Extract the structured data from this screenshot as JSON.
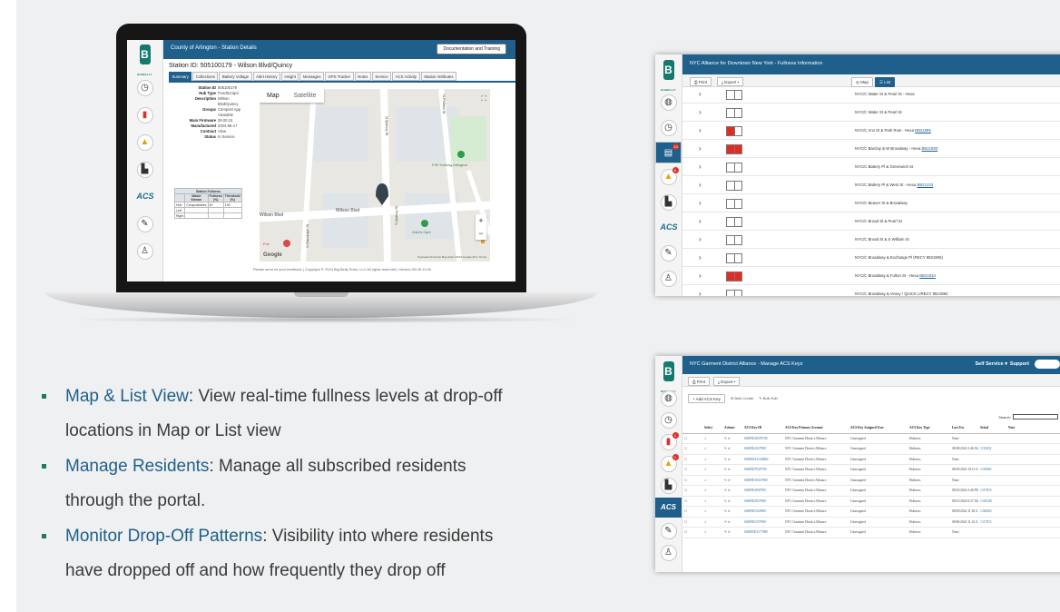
{
  "laptop": {
    "header_title": "County of Arlington - Station Details",
    "doc_button": "Documentation and Training",
    "station_title": "Station ID: 505100179 - Wilson Blvd/Quincy",
    "tabs": [
      "Summary",
      "Collections",
      "Battery Voltage",
      "Alert History",
      "Height",
      "Messages",
      "GPS Tracker",
      "Notes",
      "Service",
      "ACS Activity",
      "Station Attributes"
    ],
    "info": [
      {
        "k": "Station ID",
        "v": "505100179"
      },
      {
        "k": "Hub Type",
        "v": "FoodScrap3"
      },
      {
        "k": "Description",
        "v": "Wilson"
      },
      {
        "k": "",
        "v": "Blvd/Quincy"
      },
      {
        "k": "Groups",
        "v": "Compost App"
      },
      {
        "k": "",
        "v": "Viewable"
      },
      {
        "k": "Main Firmware",
        "v": "38.00.15"
      },
      {
        "k": "Manufactured",
        "v": "2024-06-17"
      },
      {
        "k": "Contract",
        "v": "View"
      },
      {
        "k": "Status",
        "v": "In Service"
      }
    ],
    "fullness": {
      "title": "Station Fullness",
      "headers": [
        "",
        "Waste Stream",
        "Fullness (%)",
        "Threshold (%)"
      ],
      "rows": [
        [
          "Hub",
          "Compostables",
          "40",
          "100"
        ],
        [
          "Left",
          "",
          "",
          ""
        ],
        [
          "Right",
          "",
          "",
          ""
        ]
      ]
    },
    "map": {
      "tab_map": "Map",
      "tab_satellite": "Satellite",
      "roads": {
        "wilson_left": "Wilson Blvd",
        "wilson_mid": "Wilson Blvd",
        "quincy": "N Quincy St",
        "quincy2": "N Quincy St",
        "pollard": "N Pollard St",
        "randolph": "N Randolph St"
      },
      "places": {
        "fitness": "F45 Training Arlington",
        "gym": "Gold's Gym",
        "fox": "Fox"
      },
      "google": "Google",
      "attribution": "Keyboard shortcuts  Map data ©2024 Google  20 m  Terms"
    },
    "footer": "Please send us your feedback | Copyright © 2024 Big Belly Solar, LLC All rights reserved | Version 08.08.19.00"
  },
  "panel1": {
    "title": "NYC Alliance for Downtown New York - Fullness Information",
    "print": "Print",
    "export": "Export",
    "map": "Map",
    "list": "List",
    "rows": [
      {
        "fill": [
          0,
          0
        ],
        "addr": "NYC/C Water St & Pearl St - Hexa"
      },
      {
        "fill": [
          0,
          0
        ],
        "addr": "NYC/C Water St & Pearl St"
      },
      {
        "fill": [
          1,
          0
        ],
        "addr": "NYC/C Ann St & Park Row - Hexa ",
        "link": "BB21895"
      },
      {
        "fill": [
          1,
          1
        ],
        "addr": "NYC/C Barclay & W Broadway - Hexa ",
        "link": "BB21883"
      },
      {
        "fill": [
          0,
          0
        ],
        "addr": "NYC/C Battery Pl & Greenwich St"
      },
      {
        "fill": [
          0,
          0
        ],
        "addr": "NYC/C Battery Pl & West St - Hexa ",
        "link": "BB21233"
      },
      {
        "fill": [
          0,
          0
        ],
        "addr": "NYC/C Beaver St & Broadway"
      },
      {
        "fill": [
          0,
          0
        ],
        "addr": "NYC/C Broad St & Pearl St"
      },
      {
        "fill": [
          0,
          0
        ],
        "addr": "NYC/C Broad St & S William St"
      },
      {
        "fill": [
          0,
          0
        ],
        "addr": "NYC/C Broadway & Exchange Pl (RECY 9521906)"
      },
      {
        "fill": [
          1,
          1
        ],
        "addr": "NYC/C Broadway & Fulton St - Hexa ",
        "link": "BB21834"
      },
      {
        "fill": [
          0,
          0
        ],
        "addr": "NYC/C Broadway & Vesey / QUICK LIRECY 9521892"
      }
    ],
    "rail_badges": {
      "list": "13",
      "alert": "6"
    }
  },
  "panel2": {
    "title": "NYC Garment District Alliance - Manage ACS Keys",
    "self_service": "Self Service",
    "support": "Support",
    "print": "Print",
    "export": "Export",
    "add_key": "Add ACS Key",
    "bulk_create": "Bulk Create",
    "bulk_edit": "Bulk Edit",
    "search_label": "Search:",
    "headers": [
      "",
      "Select",
      "Actions",
      "ACS Key ID",
      "ACS Key Primary Account",
      "ACS Key Assigned User",
      "ACS Key Type",
      "Last Use",
      "Serial",
      "Note"
    ],
    "rows": [
      [
        "",
        "",
        "",
        "04009E40478780",
        "NYC Garment District Alliance",
        "Unassigned",
        "Holiness",
        "None",
        "",
        ""
      ],
      [
        "",
        "",
        "",
        "04009E4347980",
        "NYC Garment District Alliance",
        "Unassigned",
        "Holiness",
        "08/28/2024 3:46 AM",
        "1132652",
        ""
      ],
      [
        "",
        "",
        "",
        "040086A2540B82",
        "NYC Garment District Alliance",
        "Unassigned",
        "Holiness",
        "None",
        "",
        ""
      ],
      [
        "",
        "",
        "",
        "04008D7E29780",
        "NYC Garment District Alliance",
        "Unassigned",
        "Holiness",
        "08/29/2024 10:15 AM",
        "1318082",
        ""
      ],
      [
        "",
        "",
        "",
        "04009E36547980",
        "NYC Garment District Alliance",
        "Unassigned",
        "Holiness",
        "None",
        "",
        ""
      ],
      [
        "",
        "",
        "",
        "04009E4038780",
        "NYC Garment District Alliance",
        "Unassigned",
        "Holiness",
        "08/23/2024 2:46 PM",
        "1317815",
        ""
      ],
      [
        "",
        "",
        "",
        "04009E4037980",
        "NYC Garment District Alliance",
        "Unassigned",
        "Holiness",
        "08/13/2024 8:27 AM",
        "1318348",
        ""
      ],
      [
        "",
        "",
        "",
        "04009E5433980",
        "NYC Garment District Alliance",
        "Unassigned",
        "Holiness",
        "08/29/2024 11:49 AM",
        "1326802",
        ""
      ],
      [
        "",
        "",
        "",
        "04009E5357980",
        "NYC Garment District Alliance",
        "Unassigned",
        "Holiness",
        "08/06/2024 11:32 AM",
        "1317815",
        ""
      ],
      [
        "",
        "",
        "",
        "040085D1577980",
        "NYC Garment District Alliance",
        "Unassigned",
        "Holiness",
        "None",
        "",
        ""
      ]
    ],
    "rail_badges": {
      "list": "1",
      "alert": "1"
    }
  },
  "bullets": [
    {
      "title": "Map & List View",
      "text": ": View real-time fullness levels at drop-off",
      "line2": "locations in Map or List view"
    },
    {
      "title": "Manage Residents",
      "text": ": Manage all subscribed residents",
      "line2": "through the portal."
    },
    {
      "title": " Monitor Drop-Off Patterns",
      "text": ": Visibility into where residents",
      "line2": "have dropped off and how frequently they drop off"
    }
  ],
  "rail_icons": [
    "gauge-icon",
    "battery-icon",
    "alert-icon",
    "chart-icon",
    "acs-icon",
    "wrench-icon",
    "user-lock-icon"
  ],
  "colors": {
    "brand_blue": "#1f5f8b",
    "logo_green": "#157a6e",
    "full_red": "#e22b22",
    "bullet_green": "#1f7a62"
  }
}
